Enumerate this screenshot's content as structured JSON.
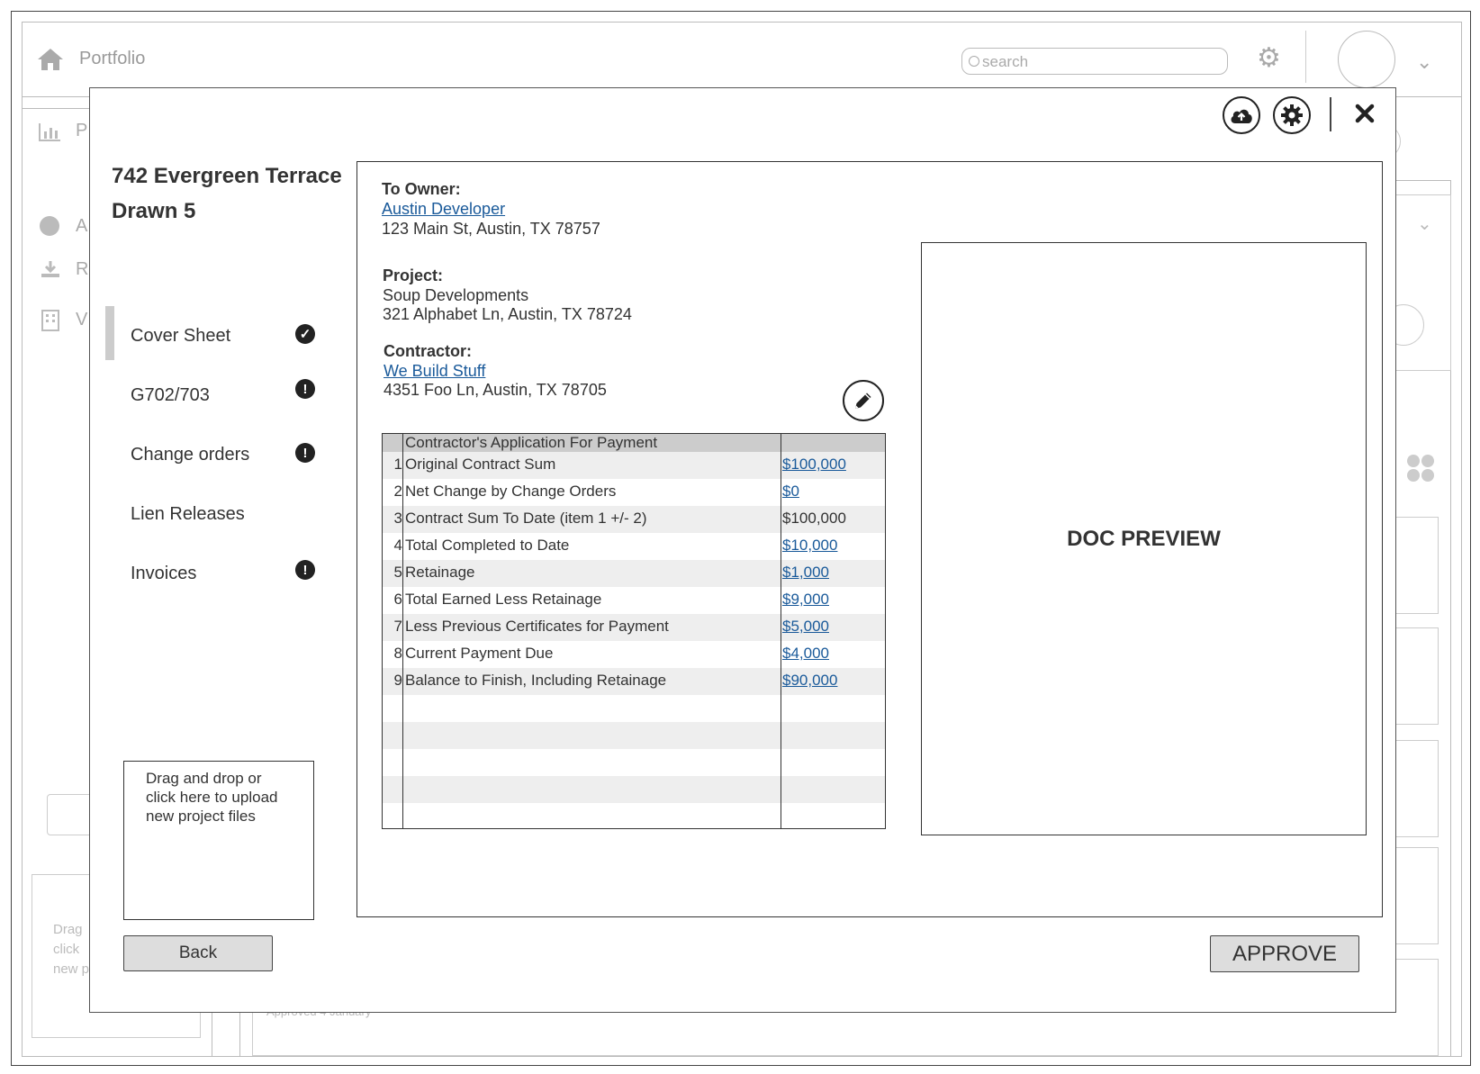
{
  "background": {
    "header_title": "Portfolio",
    "search_placeholder": "search",
    "sidebar_letters": [
      "P",
      "A",
      "R",
      "V"
    ],
    "dropzone_fragment": [
      "Drag",
      "click",
      "new p"
    ],
    "row_fragment": "Approved 4 January"
  },
  "project": {
    "title_line1": "742 Evergreen Terrace",
    "title_line2": "Drawn 5"
  },
  "nav": {
    "items": [
      {
        "label": "Cover Sheet",
        "status": "complete",
        "status_icon": "check-circle-icon"
      },
      {
        "label": "G702/703",
        "status": "attention",
        "status_icon": "exclamation-circle-icon"
      },
      {
        "label": "Change orders",
        "status": "attention",
        "status_icon": "exclamation-circle-icon"
      },
      {
        "label": "Lien Releases",
        "status": "none",
        "status_icon": ""
      },
      {
        "label": "Invoices",
        "status": "attention",
        "status_icon": "exclamation-circle-icon"
      }
    ]
  },
  "toolbar": {
    "upload_icon": "cloud-upload-icon",
    "settings_icon": "gear-icon",
    "close_icon": "close-icon"
  },
  "upload": {
    "line1": "Drag and drop or",
    "line2": "click here to upload",
    "line3": "new project files"
  },
  "buttons": {
    "back": "Back",
    "approve": "APPROVE"
  },
  "cover": {
    "owner_label": "To Owner:",
    "owner_name": "Austin Developer",
    "owner_address": "123 Main St, Austin, TX 78757",
    "project_label": "Project:",
    "project_name": "Soup Developments",
    "project_address": "321 Alphabet Ln, Austin, TX 78724",
    "contractor_label": "Contractor:",
    "contractor_name": "We Build Stuff",
    "contractor_address": "4351 Foo Ln, Austin, TX 78705",
    "edit_icon": "pencil-icon"
  },
  "application": {
    "header": "Contractor's Application For Payment",
    "rows": [
      {
        "num": "1",
        "label": "Original Contract Sum",
        "value": "$100,000",
        "link": true
      },
      {
        "num": "2",
        "label": "Net Change by Change Orders",
        "value": "$0",
        "link": true
      },
      {
        "num": "3",
        "label": "Contract Sum To Date (item 1 +/- 2)",
        "value": "$100,000",
        "link": false
      },
      {
        "num": "4",
        "label": "Total Completed to Date",
        "value": "$10,000",
        "link": true
      },
      {
        "num": "5",
        "label": "Retainage",
        "value": "$1,000",
        "link": true
      },
      {
        "num": "6",
        "label": "Total Earned Less Retainage",
        "value": "$9,000",
        "link": true
      },
      {
        "num": "7",
        "label": "Less Previous Certificates for Payment",
        "value": "$5,000",
        "link": true
      },
      {
        "num": "8",
        "label": "Current Payment Due",
        "value": "$4,000",
        "link": true
      },
      {
        "num": "9",
        "label": "Balance to Finish, Including Retainage",
        "value": "$90,000",
        "link": true
      }
    ]
  },
  "preview": {
    "label": "DOC PREVIEW"
  }
}
